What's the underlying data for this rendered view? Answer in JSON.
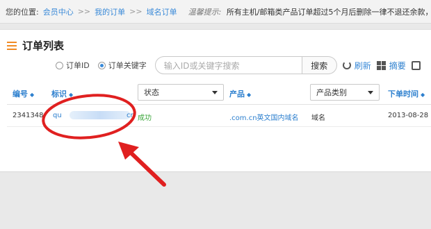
{
  "breadcrumb": {
    "label": "您的位置:",
    "items": [
      "会员中心",
      "我的订单",
      "域名订单"
    ],
    "separator": ">>",
    "tip_label": "温馨提示:",
    "tip_text": "所有主机/邮箱类产品订单超过5个月后删除一律不退还余款，所有"
  },
  "panel": {
    "title": "订单列表",
    "icon": "list-icon"
  },
  "search": {
    "radio_order_id": "订单ID",
    "radio_keyword": "订单关键字",
    "selected": "订单关键字",
    "placeholder": "输入ID或关键字搜索",
    "button": "搜索",
    "refresh": "刷新",
    "summary": "摘要"
  },
  "table": {
    "headers": {
      "id": "编号",
      "tag": "标识",
      "status": "状态",
      "product": "产品",
      "category": "产品类别",
      "order_time": "下单时间"
    },
    "sort_glyph": "◆",
    "rows": [
      {
        "id": "2341348",
        "tag_prefix": "qu",
        "tag_suffix": "cn",
        "status": "成功",
        "product": ".com.cn英文国内域名",
        "category": "域名",
        "order_time": "2013-08-28"
      }
    ]
  },
  "colors": {
    "link": "#2c7fce",
    "success": "#3aa63a",
    "annotation": "#e02020",
    "accent": "#f08a24"
  }
}
